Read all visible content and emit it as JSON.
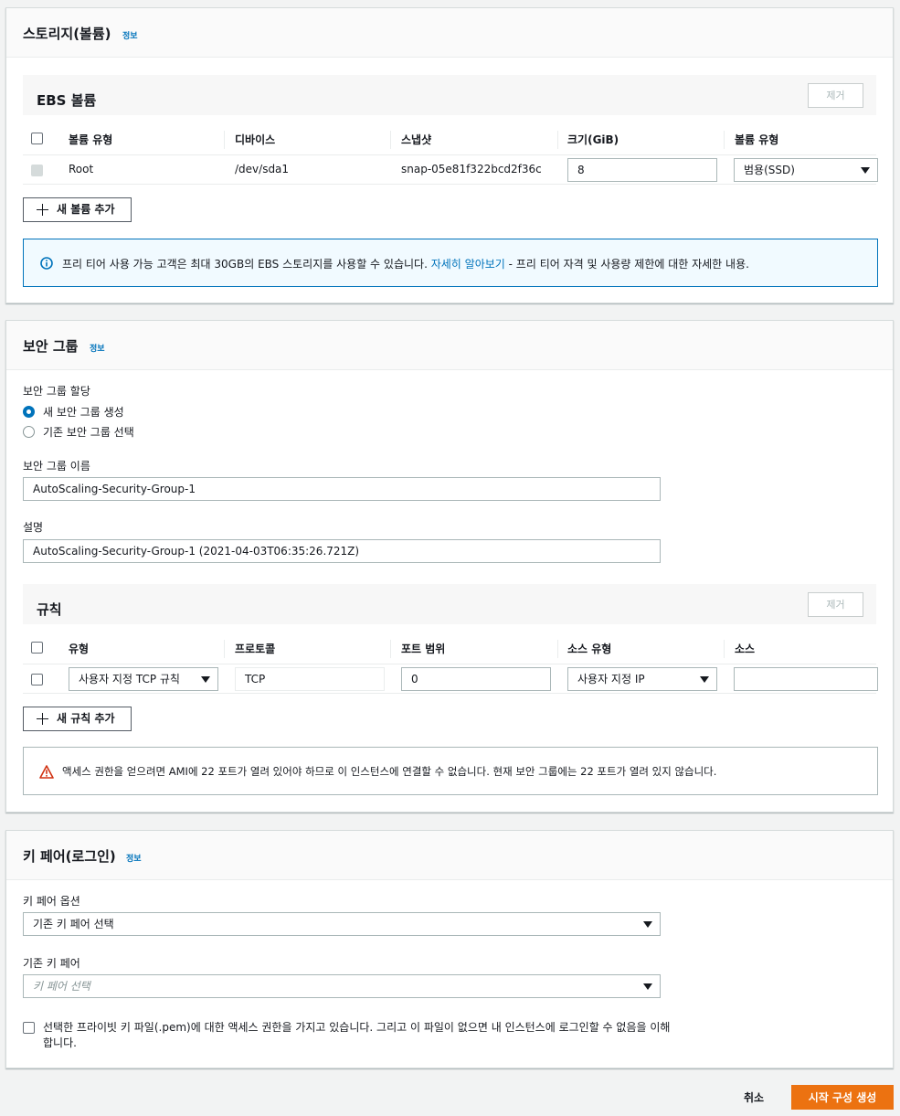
{
  "storage": {
    "title": "스토리지(볼륨)",
    "info": "정보",
    "ebs": {
      "title": "EBS 볼륨",
      "remove_label": "제거",
      "columns": [
        "볼륨 유형",
        "디바이스",
        "스냅샷",
        "크기(GiB)",
        "볼륨 유형"
      ],
      "rows": [
        {
          "volume_type": "Root",
          "device": "/dev/sda1",
          "snapshot": "snap-05e81f322bcd2f36c",
          "size": "8",
          "disk_type": "범용(SSD)"
        }
      ]
    },
    "add_volume_label": "새 볼륨 추가",
    "info_alert": {
      "text_before": "프리 티어 사용 가능 고객은 최대 30GB의 EBS 스토리지를 사용할 수 있습니다.",
      "link": "자세히 알아보기",
      "text_after": "- 프리 티어 자격 및 사용량 제한에 대한 자세한 내용."
    }
  },
  "security": {
    "title": "보안 그룹",
    "info": "정보",
    "assign_label": "보안 그룹 할당",
    "options": [
      {
        "label": "새 보안 그룹 생성",
        "selected": true
      },
      {
        "label": "기존 보안 그룹 선택",
        "selected": false
      }
    ],
    "name_label": "보안 그룹 이름",
    "name_value": "AutoScaling-Security-Group-1",
    "desc_label": "설명",
    "desc_value": "AutoScaling-Security-Group-1 (2021-04-03T06:35:26.721Z)",
    "rules": {
      "title": "규칙",
      "remove_label": "제거",
      "columns": [
        "유형",
        "프로토콜",
        "포트 범위",
        "소스 유형",
        "소스"
      ],
      "rows": [
        {
          "type": "사용자 지정 TCP 규칙",
          "protocol": "TCP",
          "port": "0",
          "source_type": "사용자 지정 IP",
          "source": ""
        }
      ]
    },
    "add_rule_label": "새 규칙 추가",
    "warning": "액세스 권한을 얻으려면 AMI에 22 포트가 열려 있어야 하므로 이 인스턴스에 연결할 수 없습니다. 현재 보안 그룹에는 22 포트가 열려 있지 않습니다."
  },
  "keypair": {
    "title": "키 페어(로그인)",
    "info": "정보",
    "option_label": "키 페어 옵션",
    "option_value": "기존 키 페어 선택",
    "existing_label": "기존 키 페어",
    "existing_placeholder": "키 페어 선택",
    "ack_line1": "선택한 프라이빗 키 파일(.pem)에 대한 액세스 권한을 가지고 있습니다. 그리고 이 파일이 없으면 내 인스턴스에 로그인할 수 없음을 이해",
    "ack_line2": "합니다."
  },
  "footer": {
    "cancel_label": "취소",
    "create_label": "시작 구성 생성"
  },
  "colors": {
    "primary": "#ec7211",
    "link": "#0073bb",
    "warning": "#d13212"
  }
}
